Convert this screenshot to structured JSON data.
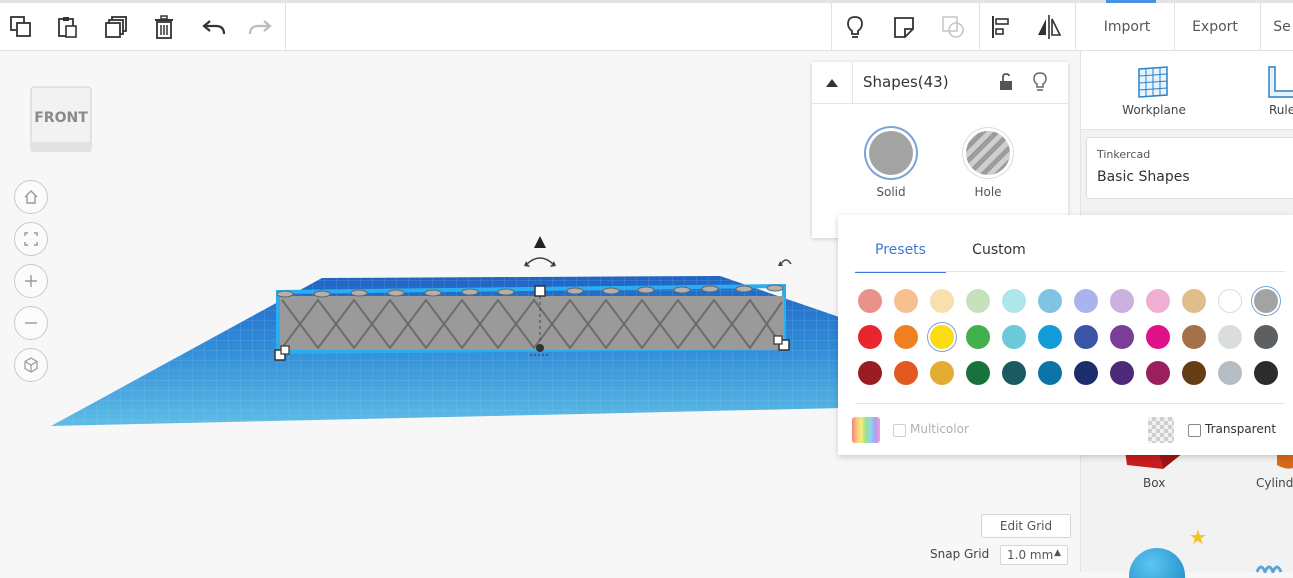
{
  "toolbar": {
    "import_label": "Import",
    "export_label": "Export",
    "send_to_label": "Se"
  },
  "viewcube": {
    "face_label": "FRONT"
  },
  "nav_buttons": [
    "home-view",
    "fit-view",
    "zoom-in",
    "zoom-out",
    "perspective"
  ],
  "inspector": {
    "title": "Shapes(43)",
    "solid_label": "Solid",
    "hole_label": "Hole"
  },
  "color_panel": {
    "tab_presets": "Presets",
    "tab_custom": "Custom",
    "active_tab": "Presets",
    "colors_row1": [
      "#e8928a",
      "#f6c090",
      "#f7e0ad",
      "#c6e2bd",
      "#aee6ec",
      "#7fc4e2",
      "#aab4ec",
      "#cbb1e0",
      "#efb0d2",
      "#dfbe8b",
      "#ffffff",
      "#a3a3a3"
    ],
    "colors_row2": [
      "#e7262d",
      "#f07f20",
      "#fbdc12",
      "#43b14b",
      "#6bc9d9",
      "#139cd8",
      "#3a55a5",
      "#7a3e98",
      "#e0128a",
      "#a3714a",
      "#d9dddd",
      "#5d6063"
    ],
    "colors_row3": [
      "#9b1c22",
      "#e15a22",
      "#e3ac32",
      "#17723c",
      "#1c5a61",
      "#0b74a7",
      "#1c2e6b",
      "#4c2a78",
      "#9a1f5e",
      "#643c15",
      "#b7bec3",
      "#2a2c2e"
    ],
    "selected_row2_index": 2,
    "selected_row1_index": 11,
    "multicolor_label": "Multicolor",
    "transparent_label": "Transparent"
  },
  "right_panel": {
    "workplane_label": "Workplane",
    "ruler_label": "Rule",
    "library_provider": "Tinkercad",
    "library_name": "Basic Shapes",
    "shape_box_label": "Box",
    "shape_cylinder_label": "Cylind"
  },
  "grid": {
    "edit_grid_label": "Edit Grid",
    "snap_grid_label": "Snap Grid",
    "snap_value": "1.0 mm"
  }
}
